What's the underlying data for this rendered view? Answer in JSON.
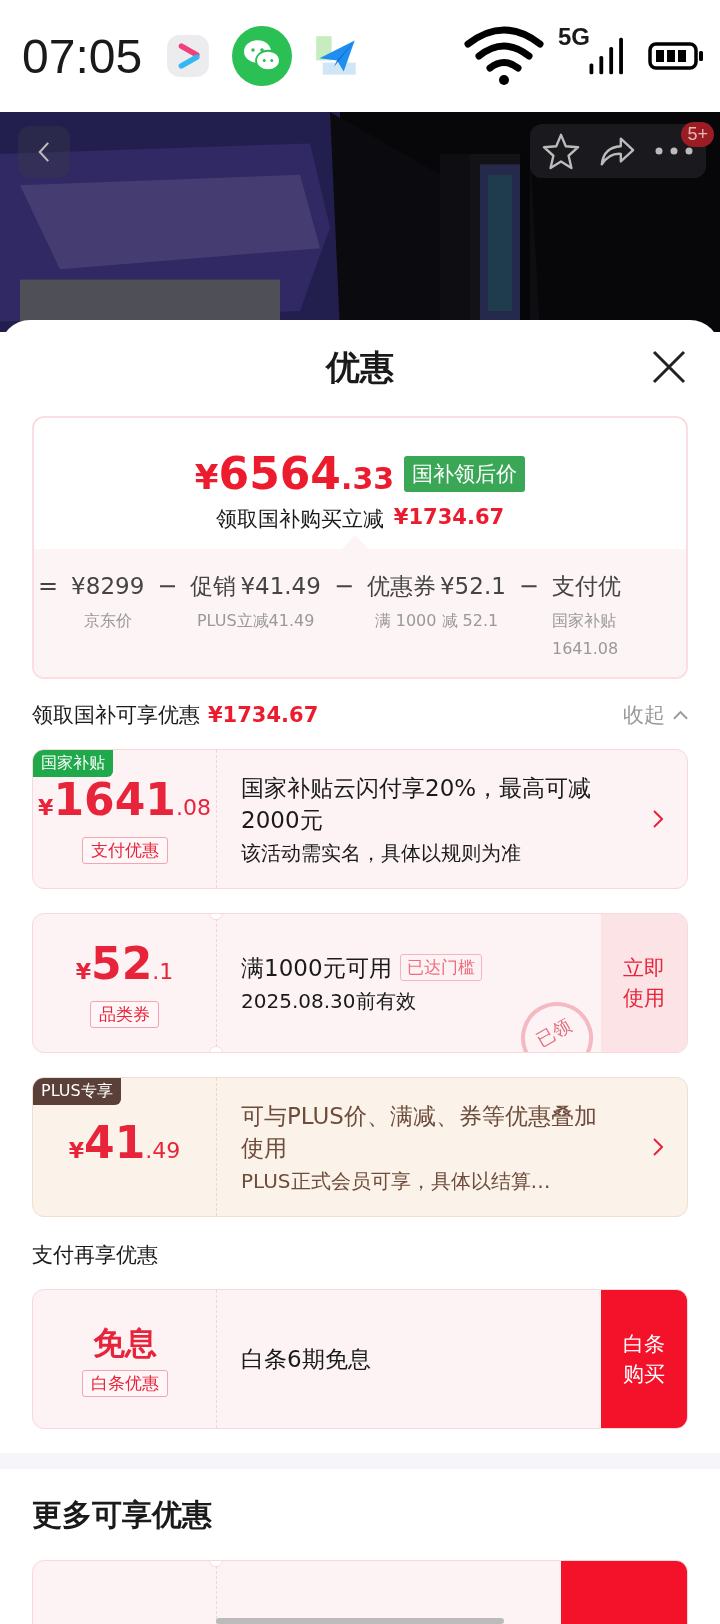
{
  "status_bar": {
    "time": "07:05",
    "network": "5G"
  },
  "header": {
    "badge": "5+"
  },
  "sheet": {
    "title": "优惠"
  },
  "price_summary": {
    "symbol": "¥",
    "integer": "6564",
    "decimal": ".33",
    "tag": "国补领后价",
    "saving_label": "领取国补购买立减",
    "saving_amount": "¥1734.67",
    "breakdown": [
      {
        "operator": "=",
        "value": "¥8299",
        "captions": [
          "京东价"
        ]
      },
      {
        "operator": "−",
        "name": "促销",
        "value": "¥41.49",
        "captions": [
          "PLUS立减41.49"
        ]
      },
      {
        "operator": "−",
        "name": "优惠券",
        "value": "¥52.1",
        "captions": [
          "满 1000 减 52.1"
        ]
      },
      {
        "operator": "−",
        "name": "支付优",
        "captions": [
          "国家补贴",
          "1641.08"
        ]
      }
    ]
  },
  "groups": [
    {
      "title": "领取国补可享优惠",
      "amount": "¥1734.67",
      "toggle": "收起",
      "expanded": true,
      "coupons": [
        {
          "kind": "standard",
          "corner_tag": {
            "kind": "subsidy",
            "text": "国家补贴"
          },
          "amount": {
            "symbol": "¥",
            "integer": "1641",
            "decimal": ".08"
          },
          "label": "支付优惠",
          "title": "国家补贴云闪付享20%，最高可减2000元",
          "subtitle": "该活动需实名，具体以规则为准",
          "action": {
            "kind": "arrow"
          }
        },
        {
          "kind": "standard",
          "notched": true,
          "amount": {
            "symbol": "¥",
            "integer": "52",
            "decimal": ".1"
          },
          "label": "品类券",
          "title": "满1000元可用",
          "threshold_tag": "已达门槛",
          "subtitle": "2025.08.30前有效",
          "stamp": "已领",
          "action": {
            "kind": "use-button",
            "text": "立即使用"
          }
        },
        {
          "kind": "plus",
          "corner_tag": {
            "kind": "plus",
            "text": "PLUS专享"
          },
          "amount": {
            "symbol": "¥",
            "integer": "41",
            "decimal": ".49"
          },
          "title": "可与PLUS价、满减、券等优惠叠加使用",
          "subtitle": "PLUS正式会员可享，具体以结算…",
          "action": {
            "kind": "arrow"
          }
        }
      ]
    },
    {
      "title": "支付再享优惠",
      "coupons": [
        {
          "kind": "standard",
          "headline": "免息",
          "label": "白条优惠",
          "title": "白条6期免息",
          "action": {
            "kind": "buy-button",
            "text": "白条购买"
          }
        }
      ]
    }
  ],
  "more": {
    "title": "更多可享优惠",
    "cards": [
      {
        "kind": "standard",
        "notched": true,
        "action": {
          "kind": "buy-button"
        }
      }
    ]
  }
}
